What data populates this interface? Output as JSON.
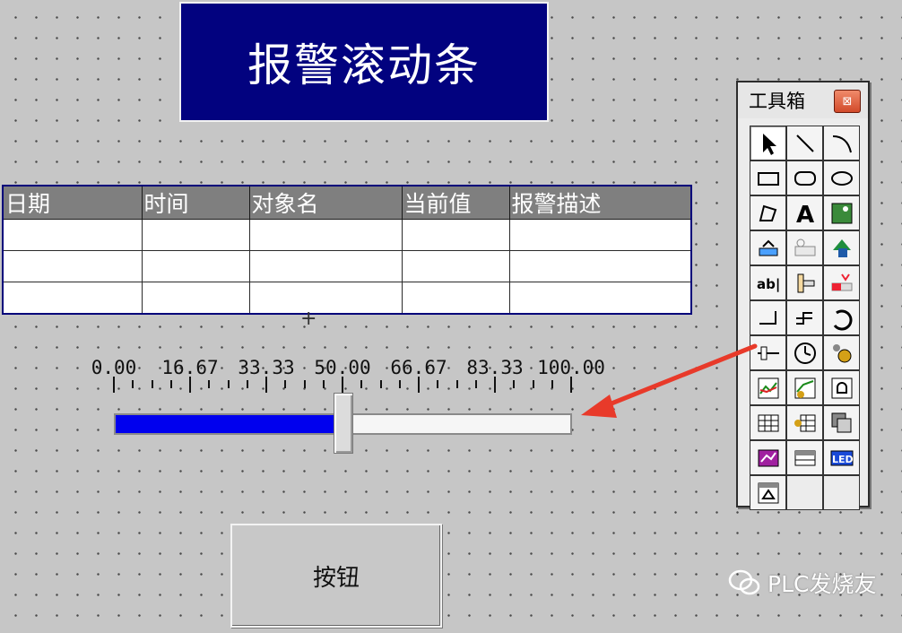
{
  "title": "报警滚动条",
  "table": {
    "headers": [
      "日期",
      "时间",
      "对象名",
      "当前值",
      "报警描述"
    ],
    "rows": [
      [
        "",
        "",
        "",
        "",
        ""
      ],
      [
        "",
        "",
        "",
        "",
        ""
      ],
      [
        "",
        "",
        "",
        "",
        ""
      ]
    ]
  },
  "slider": {
    "scale_labels": [
      "0.00",
      "16.67",
      "33.33",
      "50.00",
      "66.67",
      "83.33",
      "100.00"
    ],
    "value": 50,
    "min": 0,
    "max": 100,
    "fill_color": "#0000ee"
  },
  "button": {
    "label": "按钮"
  },
  "toolbox": {
    "title": "工具箱",
    "tools": [
      "pointer-icon",
      "line-icon",
      "arc-icon",
      "rectangle-icon",
      "rounded-rect-icon",
      "ellipse-icon",
      "polygon-icon",
      "text-icon",
      "bitmap-icon",
      "flow-icon",
      "dynamic-icon",
      "push-icon",
      "input-box-icon",
      "rectangle-scale-icon",
      "alarm-bar-icon",
      "polyline-icon",
      "stepline-icon",
      "arc-dial-icon",
      "slider-icon",
      "clock-icon",
      "knob-icon",
      "trend-icon",
      "history-trend-icon",
      "alarm-bell-icon",
      "table-icon",
      "data-table-icon",
      "combo-icon",
      "xy-curve-icon",
      "scroll-table-icon",
      "led-icon",
      "alarm-display-icon"
    ]
  },
  "colors": {
    "title_bg": "#02027f",
    "accent_arrow": "#e83a2a"
  },
  "watermark": {
    "text": "PLC发烧友"
  }
}
